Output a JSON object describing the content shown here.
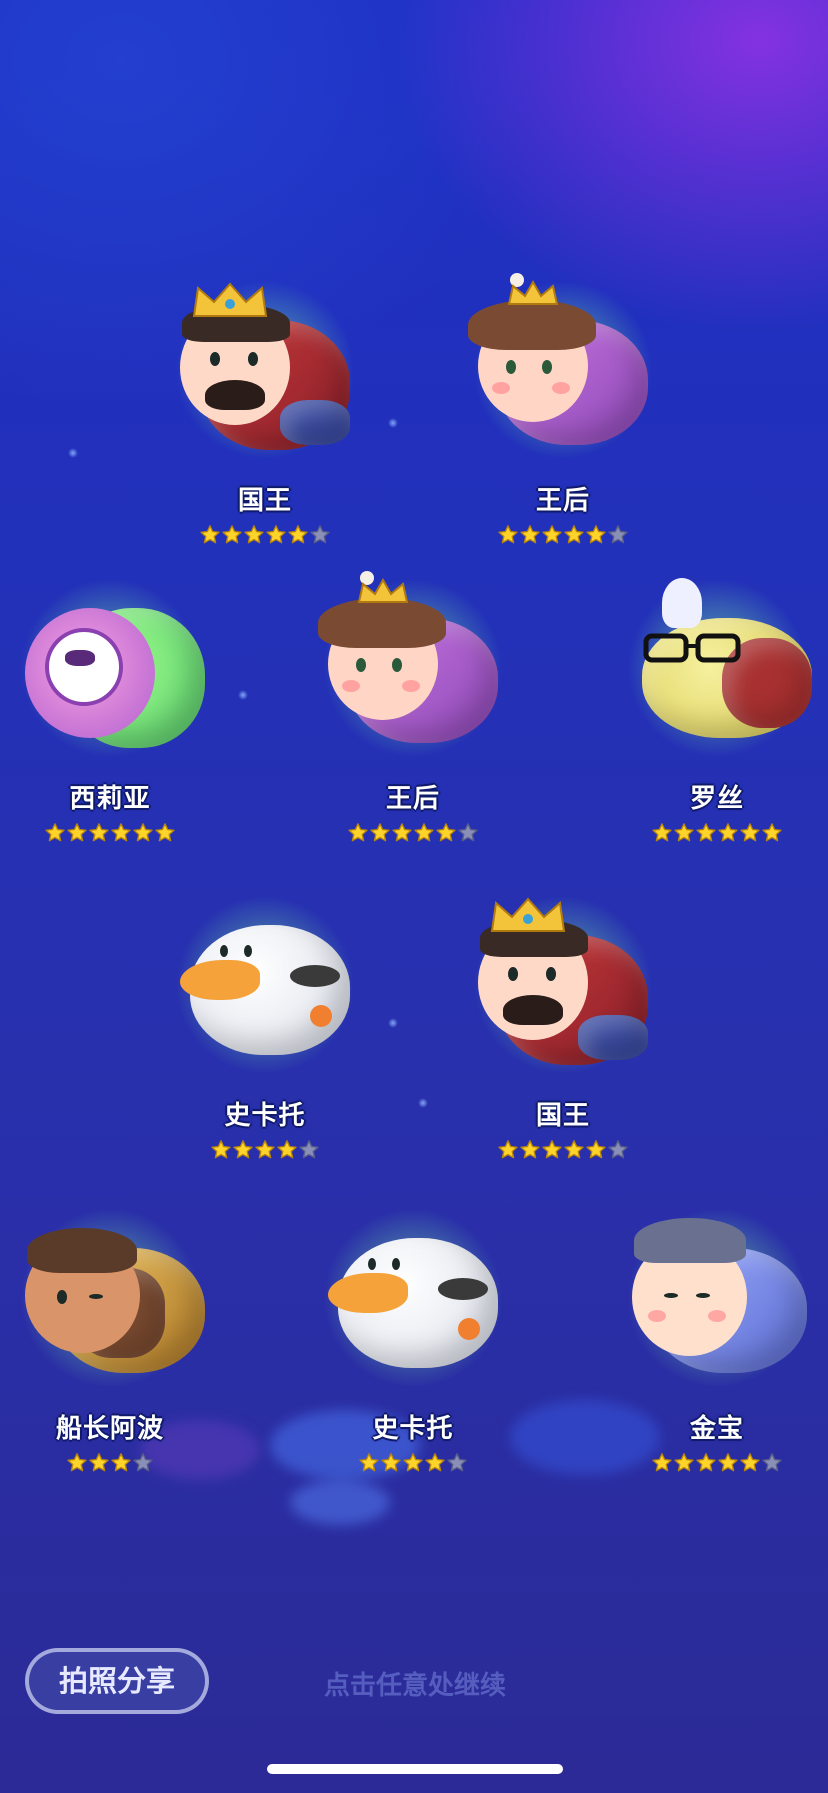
{
  "characters": [
    {
      "name": "国王",
      "stars": 5,
      "max_stars": 6,
      "kind": "king"
    },
    {
      "name": "王后",
      "stars": 5,
      "max_stars": 6,
      "kind": "queen"
    },
    {
      "name": "西莉亚",
      "stars": 6,
      "max_stars": 6,
      "kind": "celia"
    },
    {
      "name": "王后",
      "stars": 5,
      "max_stars": 6,
      "kind": "queen"
    },
    {
      "name": "罗丝",
      "stars": 6,
      "max_stars": 6,
      "kind": "roz"
    },
    {
      "name": "史卡托",
      "stars": 4,
      "max_stars": 5,
      "kind": "scuttle"
    },
    {
      "name": "国王",
      "stars": 5,
      "max_stars": 6,
      "kind": "king"
    },
    {
      "name": "船长阿波",
      "stars": 3,
      "max_stars": 4,
      "kind": "captain"
    },
    {
      "name": "史卡托",
      "stars": 4,
      "max_stars": 5,
      "kind": "scuttle"
    },
    {
      "name": "金宝",
      "stars": 5,
      "max_stars": 6,
      "kind": "jinbao"
    }
  ],
  "share_button": "拍照分享",
  "continue_hint": "点击任意处继续",
  "colors": {
    "star_filled": "#ffd42a",
    "star_empty": "#8a8fb8",
    "aura": "#8cffaa"
  }
}
